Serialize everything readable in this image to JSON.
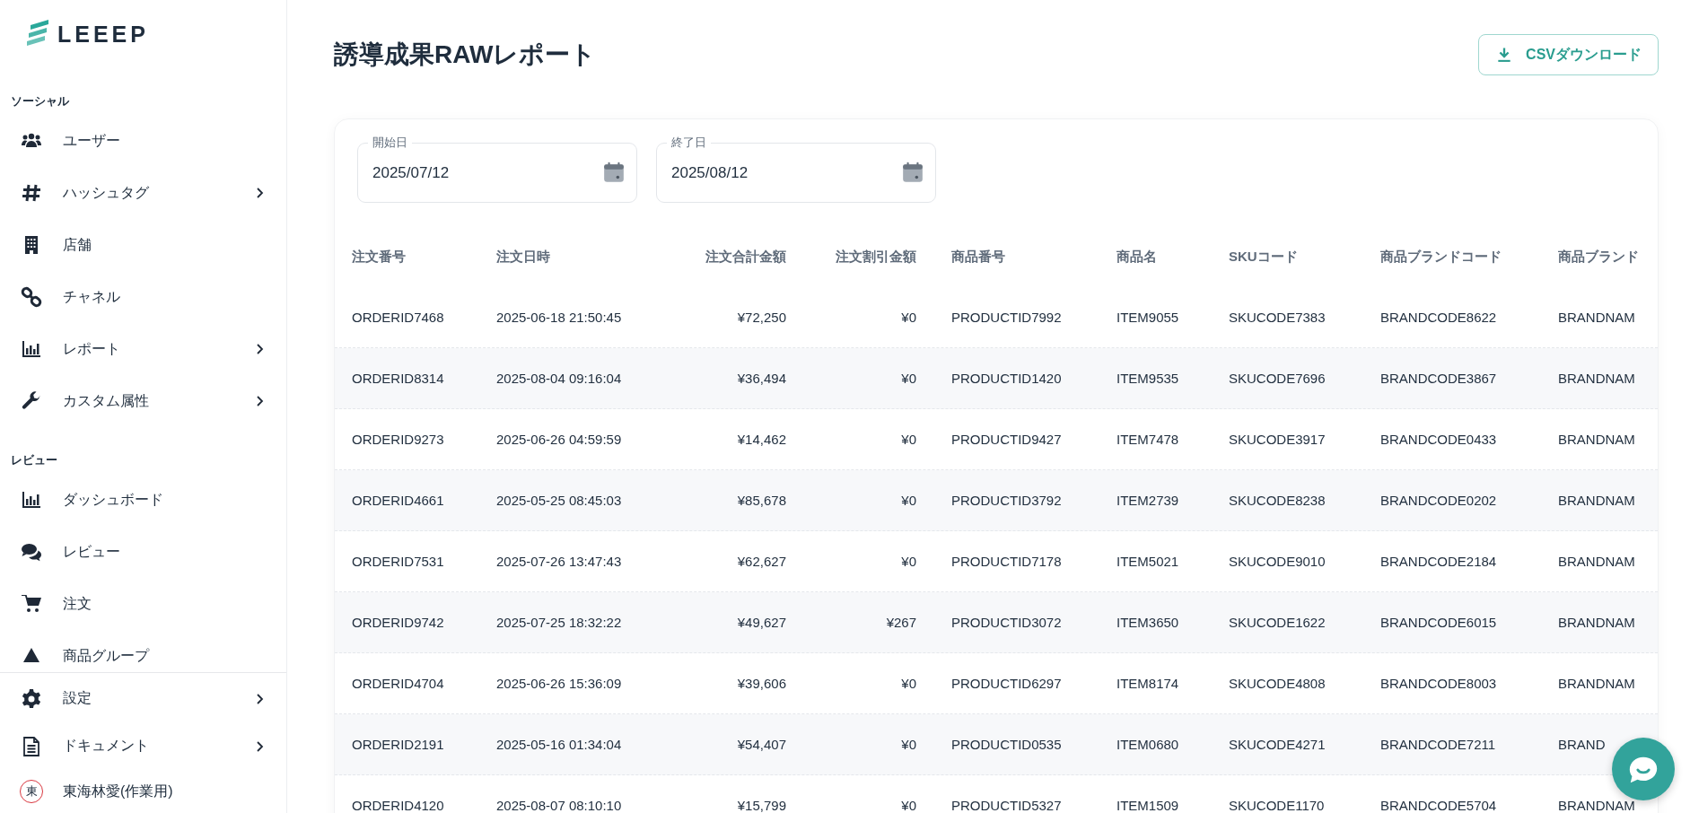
{
  "sidebar": {
    "logo": "LEEEP",
    "sections": [
      {
        "heading": "ソーシャル",
        "items": [
          {
            "label": "ユーザー",
            "expandable": false
          },
          {
            "label": "ハッシュタグ",
            "expandable": true
          },
          {
            "label": "店舗",
            "expandable": false
          },
          {
            "label": "チャネル",
            "expandable": false
          },
          {
            "label": "レポート",
            "expandable": true
          },
          {
            "label": "カスタム属性",
            "expandable": true
          }
        ]
      },
      {
        "heading": "レビュー",
        "items": [
          {
            "label": "ダッシュボード",
            "expandable": false
          },
          {
            "label": "レビュー",
            "expandable": false
          },
          {
            "label": "注文",
            "expandable": false
          },
          {
            "label": "商品グループ",
            "expandable": false
          }
        ]
      }
    ],
    "footer_items": [
      {
        "label": "設定",
        "expandable": true
      },
      {
        "label": "ドキュメント",
        "expandable": true
      }
    ],
    "user": {
      "avatar_text": "東",
      "name": "東海林愛(作業用)"
    }
  },
  "header": {
    "title": "誘導成果RAWレポート",
    "csv_button": "CSVダウンロード"
  },
  "filters": [
    {
      "label": "開始日",
      "value": "2025/07/12"
    },
    {
      "label": "終了日",
      "value": "2025/08/12"
    }
  ],
  "table": {
    "columns": [
      {
        "label": "注文番号",
        "numeric": false
      },
      {
        "label": "注文日時",
        "numeric": false
      },
      {
        "label": "注文合計金額",
        "numeric": true
      },
      {
        "label": "注文割引金額",
        "numeric": true
      },
      {
        "label": "商品番号",
        "numeric": false
      },
      {
        "label": "商品名",
        "numeric": false
      },
      {
        "label": "SKUコード",
        "numeric": false
      },
      {
        "label": "商品ブランドコード",
        "numeric": false
      },
      {
        "label": "商品ブランド",
        "numeric": false
      }
    ],
    "rows": [
      [
        "ORDERID7468",
        "2025-06-18 21:50:45",
        "¥72,250",
        "¥0",
        "PRODUCTID7992",
        "ITEM9055",
        "SKUCODE7383",
        "BRANDCODE8622",
        "BRANDNAM"
      ],
      [
        "ORDERID8314",
        "2025-08-04 09:16:04",
        "¥36,494",
        "¥0",
        "PRODUCTID1420",
        "ITEM9535",
        "SKUCODE7696",
        "BRANDCODE3867",
        "BRANDNAM"
      ],
      [
        "ORDERID9273",
        "2025-06-26 04:59:59",
        "¥14,462",
        "¥0",
        "PRODUCTID9427",
        "ITEM7478",
        "SKUCODE3917",
        "BRANDCODE0433",
        "BRANDNAM"
      ],
      [
        "ORDERID4661",
        "2025-05-25 08:45:03",
        "¥85,678",
        "¥0",
        "PRODUCTID3792",
        "ITEM2739",
        "SKUCODE8238",
        "BRANDCODE0202",
        "BRANDNAM"
      ],
      [
        "ORDERID7531",
        "2025-07-26 13:47:43",
        "¥62,627",
        "¥0",
        "PRODUCTID7178",
        "ITEM5021",
        "SKUCODE9010",
        "BRANDCODE2184",
        "BRANDNAM"
      ],
      [
        "ORDERID9742",
        "2025-07-25 18:32:22",
        "¥49,627",
        "¥267",
        "PRODUCTID3072",
        "ITEM3650",
        "SKUCODE1622",
        "BRANDCODE6015",
        "BRANDNAM"
      ],
      [
        "ORDERID4704",
        "2025-06-26 15:36:09",
        "¥39,606",
        "¥0",
        "PRODUCTID6297",
        "ITEM8174",
        "SKUCODE4808",
        "BRANDCODE8003",
        "BRANDNAM"
      ],
      [
        "ORDERID2191",
        "2025-05-16 01:34:04",
        "¥54,407",
        "¥0",
        "PRODUCTID0535",
        "ITEM0680",
        "SKUCODE4271",
        "BRANDCODE7211",
        "BRAND"
      ],
      [
        "ORDERID4120",
        "2025-08-07 08:10:10",
        "¥15,799",
        "¥0",
        "PRODUCTID5327",
        "ITEM1509",
        "SKUCODE1170",
        "BRANDCODE5704",
        "BRANDNAM"
      ]
    ]
  }
}
